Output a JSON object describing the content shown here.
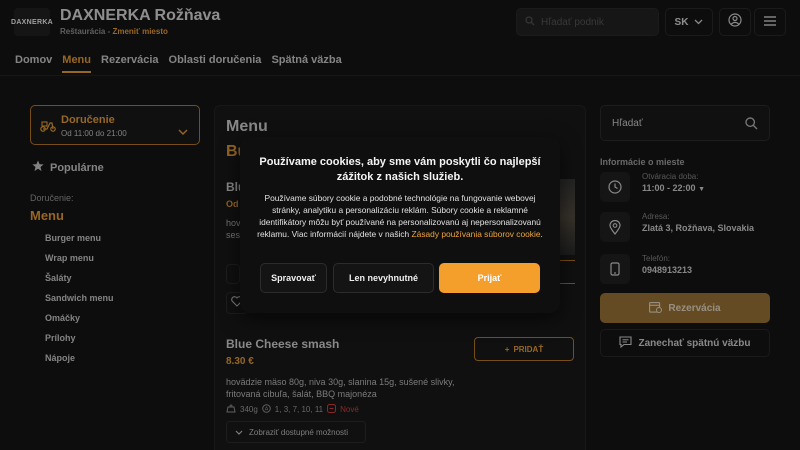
{
  "header": {
    "logo_text": "DAXNERKA",
    "restaurant_name": "DAXNERKA Rožňava",
    "restaurant_type": "Reštaurácia",
    "separator": " - ",
    "change_place": "Zmeniť miesto",
    "search_placeholder": "Hľadať podnik",
    "language": "SK"
  },
  "nav": {
    "items": [
      "Domov",
      "Menu",
      "Rezervácia",
      "Oblasti doručenia",
      "Spätná väzba"
    ],
    "active": "Menu"
  },
  "delivery": {
    "title": "Doručenie",
    "hours": "Od 11:00 do 21:00"
  },
  "sidebar": {
    "popular": "Populárne",
    "delivery_label": "Doručenie:",
    "menu_heading": "Menu",
    "categories": [
      "Burger menu",
      "Wrap menu",
      "Šaláty",
      "Sandwich menu",
      "Omáčky",
      "Prílohy",
      "Nápoje"
    ]
  },
  "menu": {
    "title": "Menu",
    "category_partial": "Bu",
    "item_partial_title": "Blu",
    "item_partial_price": "Od",
    "item_partial_desc": "hov",
    "item_partial_desc2": "ses",
    "item": {
      "name": "Blue Cheese smash",
      "price": "8.30 €",
      "description": "hovädzie mäso 80g, niva 30g, slanina 15g, sušené slivky, fritovaná cibuľa, šalát, BBQ majonéza",
      "weight": "340g",
      "allergens": "1, 3, 7, 10, 11",
      "badge": "Nové",
      "add_label": "PRIDAŤ",
      "options_label": "Zobraziť dostupné možnosti"
    }
  },
  "right": {
    "search_placeholder": "Hľadať",
    "info_heading": "Informácie o mieste",
    "opening_label": "Otváracia doba:",
    "opening_value": "11:00 - 22:00",
    "address_label": "Adresa:",
    "address_value": "Zlatá 3, Rožňava, Slovakia",
    "phone_label": "Telefón:",
    "phone_value": "0948913213",
    "reserve_label": "Rezervácia",
    "feedback_label": "Zanechať spätnú väzbu"
  },
  "cookie": {
    "title": "Používame cookies, aby sme vám poskytli čo najlepší zážitok z našich služieb.",
    "body": "Používame súbory cookie a podobné technológie na fungovanie webovej stránky, analytiku a personalizáciu reklám. Súbory cookie a reklamné identifikátory môžu byť používané na personalizovanú aj nepersonalizovanú reklamu. Viac informácií nájdete v našich",
    "policy_link": "Zásady používania súborov cookie",
    "btn_manage": "Spravovať",
    "btn_necessary": "Len nevyhnutné",
    "btn_accept": "Prijať"
  },
  "colors": {
    "accent": "#f2a53a",
    "background": "#161616",
    "accept_button": "#f49f2c"
  }
}
